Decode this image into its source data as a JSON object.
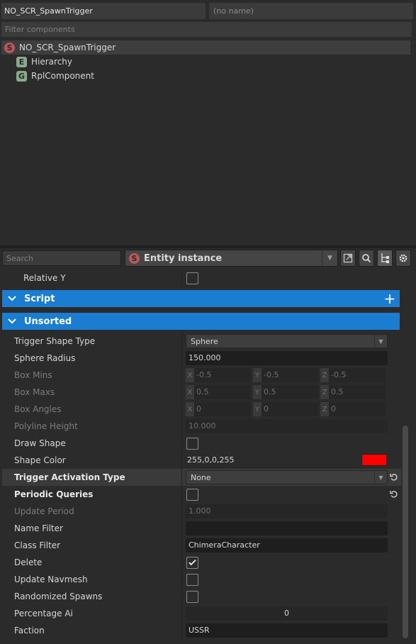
{
  "header": {
    "entity_name": "NO_SCR_SpawnTrigger",
    "name_field": "(no name)",
    "filter_placeholder": "Filter components"
  },
  "components": {
    "root": {
      "icon": "S",
      "label": "NO_SCR_SpawnTrigger"
    },
    "children": [
      {
        "icon": "E",
        "label": "Hierarchy"
      },
      {
        "icon": "G",
        "label": "RplComponent"
      }
    ]
  },
  "toolbar": {
    "search_placeholder": "Search",
    "entity_type_icon": "S",
    "entity_type": "Entity instance",
    "icons": [
      "open-external-icon",
      "search-icon",
      "hierarchy-icon",
      "gear-icon"
    ]
  },
  "properties": {
    "relative_y": {
      "label": "Relative Y"
    },
    "sections": {
      "script": "Script",
      "unsorted": "Unsorted"
    },
    "trigger_shape_type": {
      "label": "Trigger Shape Type",
      "value": "Sphere"
    },
    "sphere_radius": {
      "label": "Sphere Radius",
      "value": "150.000"
    },
    "box_mins": {
      "label": "Box Mins",
      "x": "-0.5",
      "y": "-0.5",
      "z": "-0.5"
    },
    "box_maxs": {
      "label": "Box Maxs",
      "x": "0.5",
      "y": "0.5",
      "z": "0.5"
    },
    "box_angles": {
      "label": "Box Angles",
      "x": "0",
      "y": "0",
      "z": "0"
    },
    "axis_labels": {
      "x": "X",
      "y": "Y",
      "z": "Z"
    },
    "polyline_height": {
      "label": "Polyline  Height",
      "value": "10.000"
    },
    "draw_shape": {
      "label": "Draw Shape"
    },
    "shape_color": {
      "label": "Shape Color",
      "value": "255,0,0,255",
      "swatch": "#ff0000"
    },
    "trigger_activation_type": {
      "label": "Trigger Activation Type",
      "value": "None"
    },
    "periodic_queries": {
      "label": "Periodic Queries"
    },
    "update_period": {
      "label": "Update Period",
      "value": "1.000"
    },
    "name_filter": {
      "label": "Name Filter",
      "value": ""
    },
    "class_filter": {
      "label": "Class Filter",
      "value": "ChimeraCharacter"
    },
    "delete": {
      "label": "Delete",
      "checked": true
    },
    "update_navmesh": {
      "label": "Update Navmesh"
    },
    "randomized_spawns": {
      "label": "Randomized Spawns"
    },
    "percentage_ai": {
      "label": "Percentage Ai",
      "value": "0"
    },
    "faction": {
      "label": "Faction",
      "value": "USSR"
    }
  },
  "colors": {
    "accent": "#1a7dd2",
    "background": "#2b2b2b"
  }
}
